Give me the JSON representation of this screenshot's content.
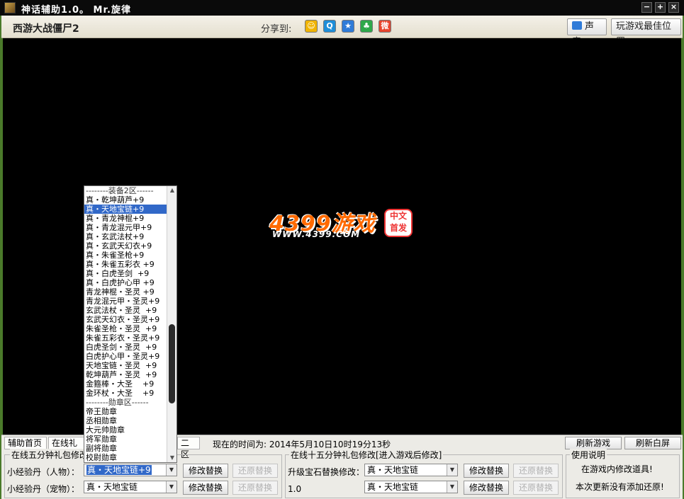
{
  "window": {
    "title": "神话辅助1.0。 Mr.旋律",
    "buttons": [
      "−",
      "+",
      "×"
    ]
  },
  "header": {
    "game_title": "西游大战僵尸2",
    "share_label": "分享到:",
    "share_icons": [
      {
        "name": "qzone-icon",
        "glyph": "☺",
        "color": "#f0b400"
      },
      {
        "name": "qq-icon",
        "glyph": "Q",
        "color": "#1e8ed8"
      },
      {
        "name": "star-icon",
        "glyph": "★",
        "color": "#2f7bd8"
      },
      {
        "name": "clover-icon",
        "glyph": "♣",
        "color": "#ffffff"
      },
      {
        "name": "weibo-icon",
        "glyph": "微",
        "color": "#e8452e"
      }
    ],
    "sound_label": "声音",
    "best_position_label": "玩游戏最佳位置"
  },
  "game": {
    "logo_text": "4399游戏",
    "logo_url": "WWW.4399.COM",
    "seal_text": "中文 首发"
  },
  "panel": {
    "tabs": [
      "辅助首页",
      "在线礼包",
      "二区"
    ],
    "time_text": "现在的时间为: 2014年5月10日10时19分13秒",
    "refresh_game": "刷新游戏",
    "refresh_screen": "刷新白屏",
    "group1_legend": "在线五分钟礼包修改",
    "row1_label": "小经验丹（人物）：",
    "row1_value": "真・天地宝链+9",
    "row2_label": "小经验丹（宠物）：",
    "row2_value": "真・天地宝链",
    "modify_label": "修改替换",
    "restore_label": "还原替换",
    "group2_legend": "在线十五分钟礼包修改[进入游戏后修改]",
    "gem_label": "升级宝石替换修改：",
    "gem_value": "真・天地宝链",
    "version": "1.0",
    "row4_value": "真・天地宝链",
    "group3_legend": "使用说明",
    "note1": "在游戏内修改道具!",
    "note2": "本次更新没有添加还原!"
  },
  "dropdown": {
    "items": [
      "--------装备2区------",
      "真・乾坤葫芦+9",
      "真・天地宝链+9",
      "真・青龙神棍+9",
      "真・青龙混元甲+9",
      "真・玄武法杖+9",
      "真・玄武天幻衣+9",
      "真・朱雀圣枪+9",
      "真・朱雀五彩衣 +9",
      "真・白虎圣剑  +9",
      "真・白虎护心甲 +9",
      "青龙神棍・圣灵 +9",
      "青龙混元甲・圣灵+9",
      "玄武法杖・圣灵  +9",
      "玄武天幻衣・圣灵+9",
      "朱雀圣枪・圣灵  +9",
      "朱雀五彩衣・圣灵+9",
      "白虎圣剑・圣灵  +9",
      "白虎护心甲・圣灵+9",
      "天地宝链・圣灵  +9",
      "乾坤葫芦・圣灵  +9",
      "金箍棒・大圣    +9",
      "金环杖・大圣    +9",
      "--------勋章区------",
      "帝王勋章",
      "丞相勋章",
      "大元帅勋章",
      "将军勋章",
      "副将勋章",
      "校尉勋章"
    ],
    "selected_index": 2
  }
}
